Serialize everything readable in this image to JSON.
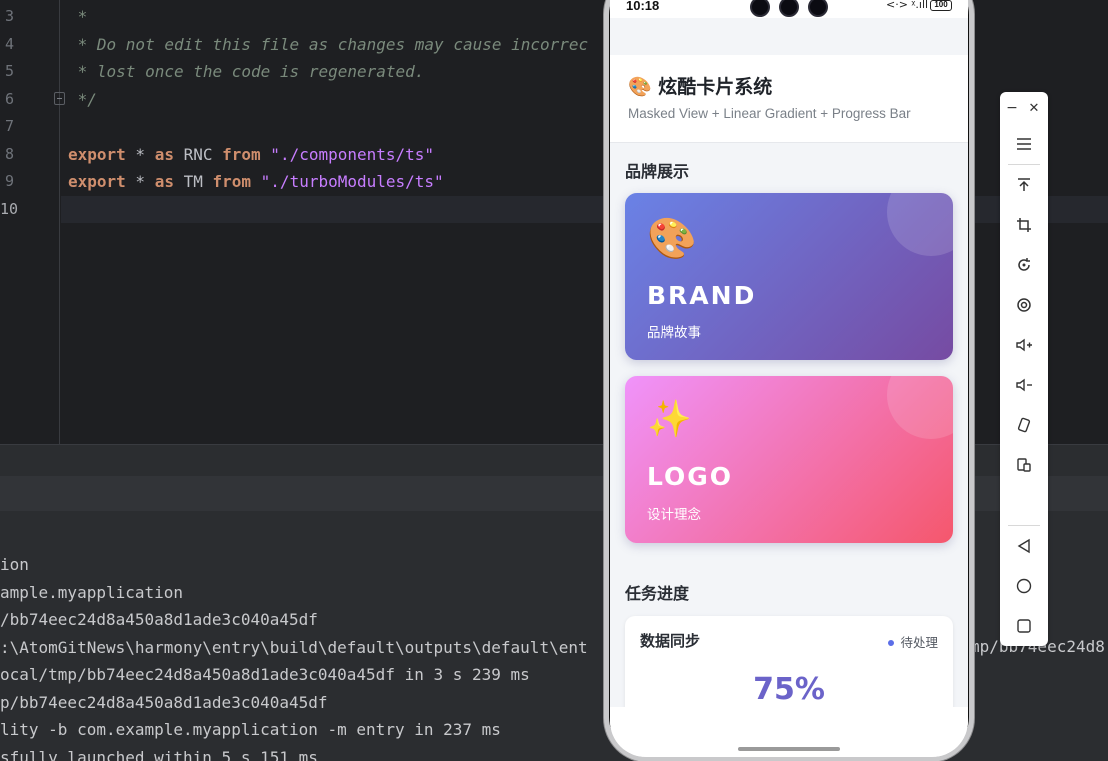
{
  "editor": {
    "line_numbers": [
      "3",
      "4",
      "5",
      "6",
      "7",
      "8",
      "9",
      "10"
    ],
    "comment_lines": [
      " *",
      " * Do not edit this file as changes may cause incorrec",
      " * lost once the code is regenerated.",
      " */"
    ],
    "export_lines": [
      {
        "kw1": "export",
        "star": " * ",
        "kw2": "as",
        "name": " RNC ",
        "kw3": "from",
        "path": " \"./components/ts\""
      },
      {
        "kw1": "export",
        "star": " * ",
        "kw2": "as",
        "name": " TM ",
        "kw3": "from",
        "path": " \"./turboModules/ts\""
      }
    ]
  },
  "console": {
    "lines": [
      "ion",
      "ample.myapplication",
      "/bb74eec24d8a450a8d1ade3c040a45df",
      ":\\AtomGitNews\\harmony\\entry\\build\\default\\outputs\\default\\ent",
      "ocal/tmp/bb74eec24d8a450a8d1ade3c040a45df in 3 s 239 ms",
      "p/bb74eec24d8a450a8d1ade3c040a45df",
      "lity -b com.example.myapplication -m entry in 237 ms",
      "sfully launched within 5 s 151 ms"
    ],
    "right_fragment": "mp/bb74eec24d8"
  },
  "toolbar": {
    "minimize": "−",
    "close": "✕",
    "icons": [
      "menu-icon",
      "pin-top-icon",
      "crop-icon",
      "rotate-icon",
      "screenshot-icon",
      "volume-up-icon",
      "volume-down-icon",
      "shake-icon",
      "multi-device-icon",
      "back-icon",
      "home-icon",
      "recents-icon"
    ]
  },
  "phone": {
    "status": {
      "time": "10:18",
      "network": "<·> ᵡ.ıll",
      "battery": "100"
    },
    "header": {
      "title": "🎨 炫酷卡片系统",
      "subtitle": "Masked View + Linear Gradient + Progress Bar"
    },
    "brand_section": {
      "title": "品牌展示",
      "cards": [
        {
          "emoji": "🎨",
          "title": "BRAND",
          "subtitle": "品牌故事",
          "gradient": [
            "#6a82e6",
            "#764ba2"
          ]
        },
        {
          "emoji": "✨",
          "title": "LOGO",
          "subtitle": "设计理念",
          "gradient": [
            "#f093fb",
            "#f5576c"
          ]
        }
      ]
    },
    "task_section": {
      "title": "任务进度",
      "tasks": [
        {
          "name": "数据同步",
          "status": "待处理",
          "percent": "75%",
          "progress": 0.75
        }
      ]
    }
  },
  "colors": {
    "ide_bg": "#1e1f22",
    "keyword": "#cf8e6d",
    "string": "#c77dff",
    "comment": "#7a8a7c",
    "accent_purple": "#6b63c9",
    "status_dot": "#5b6ee8"
  }
}
